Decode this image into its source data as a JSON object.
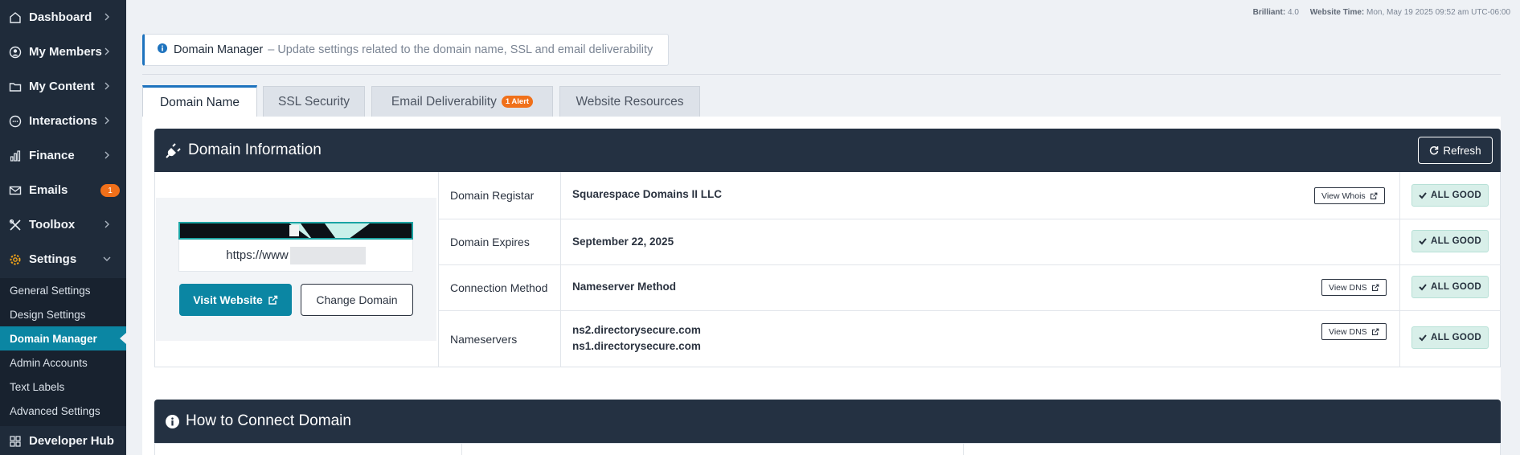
{
  "header": {
    "brilliant_label": "Brilliant:",
    "brilliant_value": "4.0",
    "website_time_label": "Website Time:",
    "website_time_value": "Mon, May 19 2025 09:52 am UTC-06:00"
  },
  "sidebar": {
    "items": [
      {
        "label": "Dashboard",
        "icon": "home-icon"
      },
      {
        "label": "My Members",
        "icon": "user-icon"
      },
      {
        "label": "My Content",
        "icon": "folder-icon"
      },
      {
        "label": "Interactions",
        "icon": "chat-icon"
      },
      {
        "label": "Finance",
        "icon": "bar-chart-icon"
      },
      {
        "label": "Emails",
        "icon": "email-icon",
        "badge": "1"
      },
      {
        "label": "Toolbox",
        "icon": "tools-icon"
      },
      {
        "label": "Settings",
        "icon": "gear-icon"
      }
    ],
    "settings_submenu": [
      "General Settings",
      "Design Settings",
      "Domain Manager",
      "Admin Accounts",
      "Text Labels",
      "Advanced Settings"
    ],
    "developer_hub": "Developer Hub"
  },
  "notice": {
    "title": "Domain Manager",
    "description": "– Update settings related to the domain name, SSL and email deliverability"
  },
  "tabs": [
    {
      "label": "Domain Name",
      "active": true
    },
    {
      "label": "SSL Security"
    },
    {
      "label": "Email Deliverability",
      "badge": "1 Alert"
    },
    {
      "label": "Website Resources"
    }
  ],
  "domain_info": {
    "title": "Domain Information",
    "refresh_label": "Refresh",
    "url_prefix": "https://www",
    "visit_label": "Visit Website",
    "change_label": "Change Domain",
    "status_label": "ALL GOOD",
    "rows": [
      {
        "label": "Domain Registar",
        "value": "Squarespace Domains II LLC",
        "action": "View Whois"
      },
      {
        "label": "Domain Expires",
        "value": "September 22, 2025"
      },
      {
        "label": "Connection Method",
        "value": "Nameserver Method",
        "action": "View DNS"
      },
      {
        "label": "Nameservers",
        "value": "ns2.directorysecure.com",
        "value2": "ns1.directorysecure.com",
        "action": "View DNS"
      }
    ]
  },
  "how_to": {
    "title": "How to Connect Domain"
  },
  "colors": {
    "sidebar": "#1f2b3a",
    "accent": "#0b86a3",
    "alert": "#f0701a",
    "good_bg": "#d8efe9",
    "panel_header": "#243142"
  }
}
